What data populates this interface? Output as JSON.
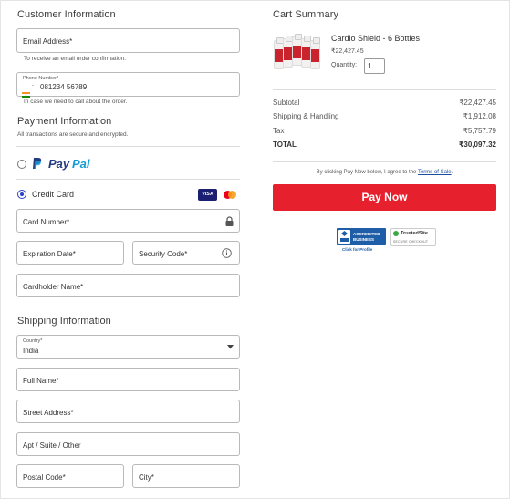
{
  "customer": {
    "title": "Customer Information",
    "email_label": "Email Address*",
    "email_help": "To receive an email order confirmation.",
    "phone_label": "Phone Number*",
    "phone_prefix": "-",
    "phone_value": "081234 56789",
    "phone_help": "In case we need to call about the order."
  },
  "payment": {
    "title": "Payment Information",
    "subtitle": "All transactions are secure and encrypted.",
    "paypal_pay": "Pay",
    "paypal_pal": "Pal",
    "credit_card_label": "Credit Card",
    "visa_label": "VISA",
    "card_number_label": "Card Number*",
    "expiration_label": "Expiration Date*",
    "security_code_label": "Security Code*",
    "cardholder_label": "Cardholder Name*",
    "selected_method": "credit_card"
  },
  "shipping": {
    "title": "Shipping Information",
    "country_label": "Country*",
    "country_value": "India",
    "full_name_label": "Full Name*",
    "street_label": "Street Address*",
    "apt_label": "Apt / Suite / Other",
    "postal_label": "Postal Code*",
    "city_label": "City*"
  },
  "cart": {
    "title": "Cart Summary",
    "product_name": "Cardio Shield - 6 Bottles",
    "product_price": "₹22,427.45",
    "quantity_label": "Quantity:",
    "quantity_value": "1",
    "subtotal_label": "Subtotal",
    "subtotal_value": "₹22,427.45",
    "shipping_label": "Shipping & Handling",
    "shipping_value": "₹1,912.08",
    "tax_label": "Tax",
    "tax_value": "₹5,757.79",
    "total_label": "TOTAL",
    "total_value": "₹30,097.32",
    "terms_prefix": "By clicking Pay Now below, I agree to the ",
    "terms_link": "Terms of Sale",
    "terms_suffix": ".",
    "pay_button": "Pay Now",
    "bbb_line1": "ACCREDITED",
    "bbb_line2": "BUSINESS",
    "bbb_caption": "Click for Profile",
    "trustedsite_line1": "TrustedSite",
    "trustedsite_line2": "SECURE CHECKOUT"
  },
  "colors": {
    "accent": "#2b3fc8",
    "pay_button": "#e7202d",
    "paypal_dark": "#253b80",
    "paypal_light": "#179bd7",
    "link": "#1a4fa0"
  }
}
